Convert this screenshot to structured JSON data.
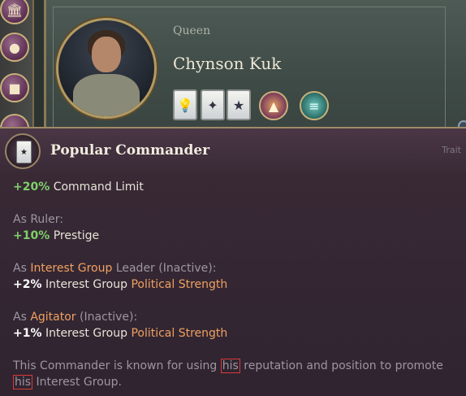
{
  "character": {
    "title": "Queen",
    "name": "Chynson Kuk"
  },
  "left_strip_icons": [
    "government-building-icon",
    "coins-icon",
    "factory-icon"
  ],
  "trait_icons": [
    "lightbulb-icon",
    "sparkle-icon",
    "commander-icon"
  ],
  "round_icons": [
    "interest-group-icon",
    "ideology-icon"
  ],
  "tooltip": {
    "title": "Popular Commander",
    "kind": "Trait",
    "effect1_value": "+20%",
    "effect1_label": "Command Limit",
    "ruler_heading": "As Ruler:",
    "ruler_value": "+10%",
    "ruler_label": "Prestige",
    "ig_as": "As",
    "ig_link": "Interest Group",
    "ig_leader": "Leader (Inactive):",
    "ig_value": "+2%",
    "ig_label_a": "Interest Group",
    "ig_label_b": "Political Strength",
    "agitator_as": "As",
    "agitator_link": "Agitator",
    "agitator_rest": "(Inactive):",
    "agitator_value": "+1%",
    "agitator_label_a": "Interest Group",
    "agitator_label_b": "Political Strength",
    "desc_part1": "This Commander is known for using ",
    "desc_his1": "his",
    "desc_part2": " reputation and position to promote ",
    "desc_his2": "his",
    "desc_part3": " Interest Group."
  },
  "colors": {
    "positive": "#7fd06a",
    "link": "#f0a062",
    "highlight_box": "#d93a3a"
  }
}
